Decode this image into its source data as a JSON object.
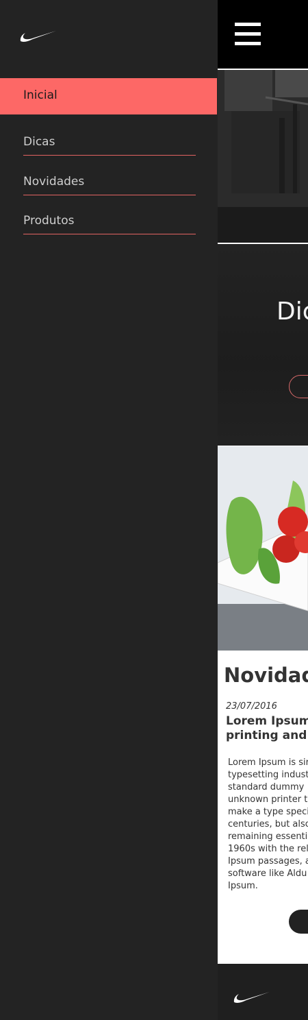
{
  "sidebar": {
    "logo": "nike-swoosh-icon",
    "items": [
      {
        "label": "Inicial",
        "active": true
      },
      {
        "label": "Dicas",
        "active": false
      },
      {
        "label": "Novidades",
        "active": false
      },
      {
        "label": "Produtos",
        "active": false
      }
    ]
  },
  "topbar": {
    "menu_icon": "hamburger-icon"
  },
  "dicas_section": {
    "title_partial": "Dic"
  },
  "news": {
    "heading_partial": "Novidad",
    "date": "23/07/2016",
    "title_partial": "Lorem Ipsum\nprinting and t",
    "body_partial": "Lorem Ipsum is sir\ntypesetting indust\nstandard dummy\nunknown printer t\nmake a type speci\ncenturies, but also\nremaining essenti\n1960s with the rel\nIpsum passages, a\nsoftware like Aldu\nIpsum."
  },
  "footer": {
    "logo": "nike-swoosh-icon"
  },
  "colors": {
    "accent": "#fd6866",
    "sidebar_bg": "#232323",
    "topbar_bg": "#000000"
  }
}
